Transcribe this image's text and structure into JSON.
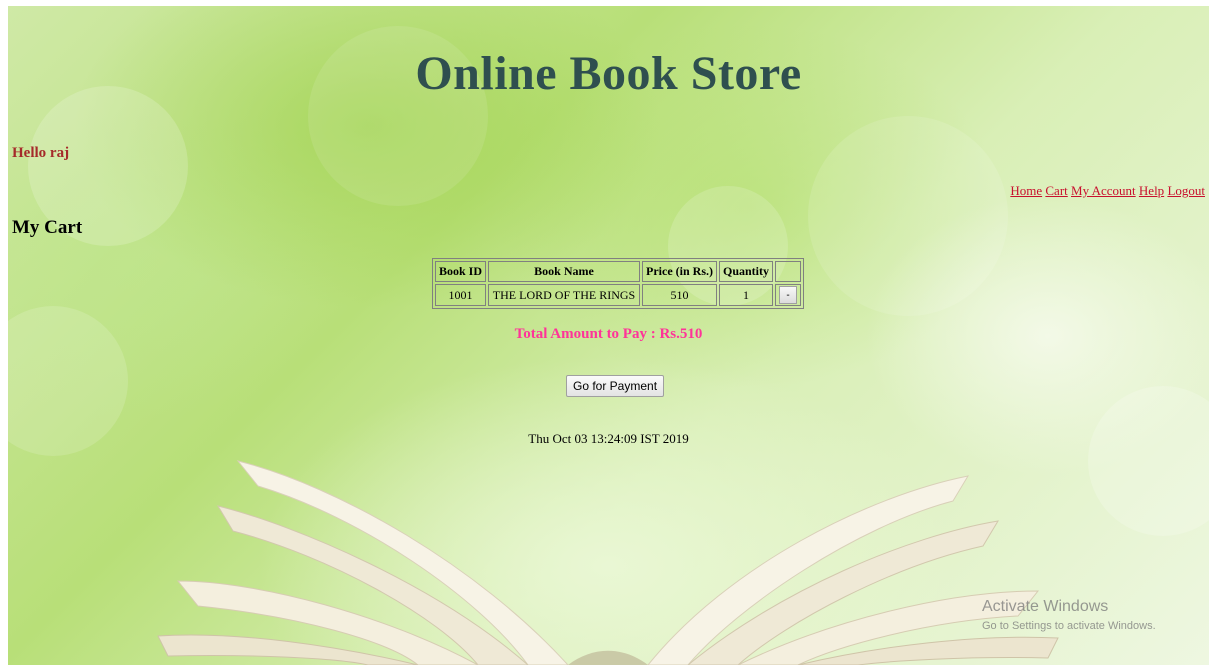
{
  "header": {
    "title": "Online Book Store"
  },
  "user": {
    "greeting": "Hello raj"
  },
  "nav": {
    "home": "Home",
    "cart": "Cart",
    "account": "My Account",
    "help": "Help",
    "logout": "Logout"
  },
  "cart": {
    "heading": "My Cart",
    "columns": [
      "Book ID",
      "Book Name",
      "Price (in Rs.)",
      "Quantity"
    ],
    "rows": [
      {
        "book_id": "1001",
        "book_name": "THE LORD OF THE RINGS",
        "price": "510",
        "quantity": "1",
        "remove_label": "-"
      }
    ],
    "total": "Total Amount to Pay : Rs.510",
    "pay_button": "Go for Payment"
  },
  "footer": {
    "datetime": "Thu Oct 03 13:24:09 IST 2019"
  },
  "watermark": {
    "title": "Activate Windows",
    "subtitle": "Go to Settings to activate Windows."
  },
  "colors": {
    "title": "#2f4f4f",
    "greeting": "#a52a2a",
    "links": "#c8102e",
    "total": "#ff3399"
  }
}
